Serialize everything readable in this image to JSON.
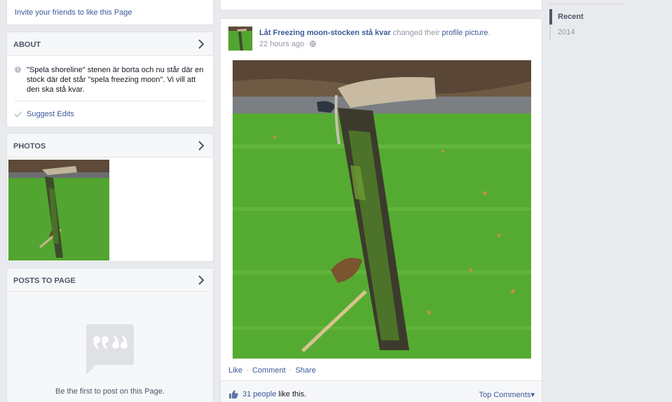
{
  "sidebar": {
    "invite_label": "Invite your friends to like this Page",
    "about": {
      "title": "ABOUT",
      "description": "\"Spela shoreline\" stenen är borta och nu står där en stock där det står \"spela freezing moon\". Vi vill att den ska stå kvar.",
      "suggest_label": "Suggest Edits"
    },
    "photos": {
      "title": "PHOTOS"
    },
    "posts": {
      "title": "POSTS TO PAGE",
      "empty_text": "Be the first to post on this Page."
    }
  },
  "post": {
    "actor": "Låt Freezing moon-stocken stå kvar",
    "verb": " changed their ",
    "object": "profile picture",
    "object_suffix": ".",
    "timestamp": "22 hours ago",
    "actions": {
      "like": "Like",
      "comment": "Comment",
      "share": "Share",
      "separator": "·"
    },
    "likes_count": "31 people",
    "likes_suffix": " like this.",
    "top_comments": "Top Comments",
    "top_comments_caret": "▾"
  },
  "scrubber": {
    "items": [
      {
        "label": "Recent",
        "active": true
      },
      {
        "label": "2014",
        "active": false
      }
    ]
  },
  "colors": {
    "link": "#3b5998",
    "background": "#e9eaed",
    "muted": "#9197a3"
  },
  "icons": [
    "chevron-right-icon",
    "info-icon",
    "checkmark-icon",
    "quote-bubble-icon",
    "globe-icon",
    "thumbs-up-icon"
  ]
}
